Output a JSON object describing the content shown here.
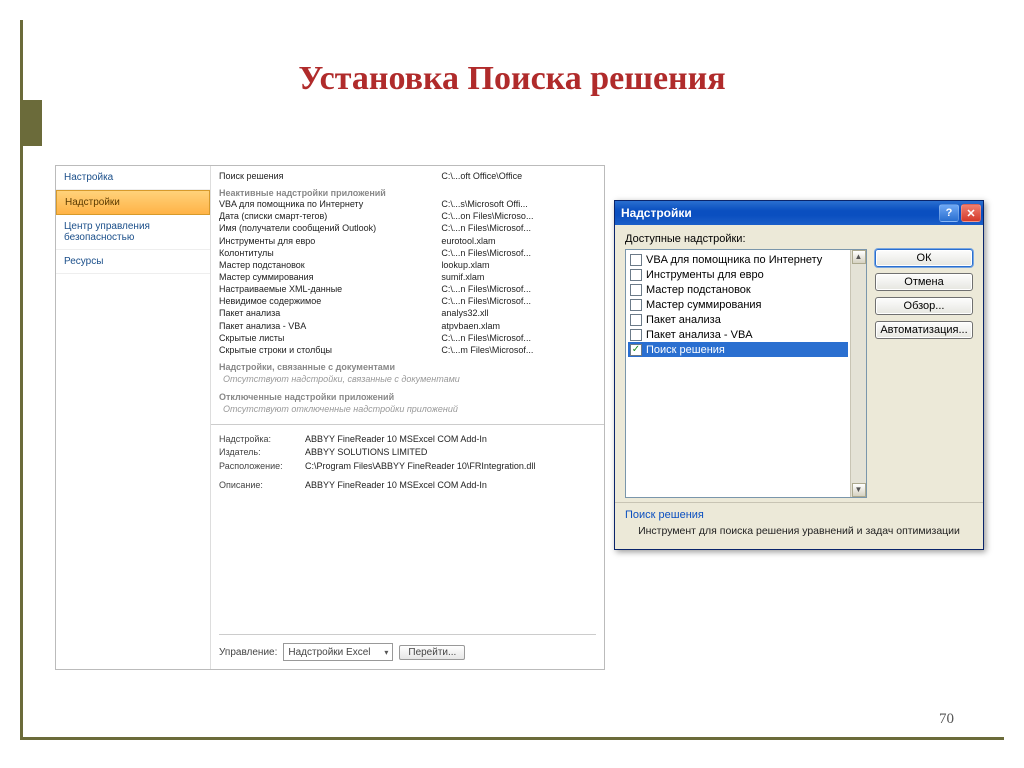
{
  "slide": {
    "title": "Установка Поиска решения",
    "page": "70"
  },
  "excel_options": {
    "sidebar": [
      "Настройка",
      "Надстройки",
      "Центр управления безопасностью",
      "Ресурсы"
    ],
    "selected_sidebar_index": 1,
    "top_item_name": "Поиск решения",
    "top_item_path": "C:\\...oft Office\\Office",
    "section_inactive": "Неактивные надстройки приложений",
    "inactive_list": [
      {
        "name": "VBA для помощника по Интернету",
        "path": "C:\\...s\\Microsoft Offi..."
      },
      {
        "name": "Дата (списки смарт-тегов)",
        "path": "C:\\...on Files\\Microso..."
      },
      {
        "name": "Имя (получатели сообщений Outlook)",
        "path": "C:\\...n Files\\Microsof..."
      },
      {
        "name": "Инструменты для евро",
        "path": "eurotool.xlam"
      },
      {
        "name": "Колонтитулы",
        "path": "C:\\...n Files\\Microsof..."
      },
      {
        "name": "Мастер подстановок",
        "path": "lookup.xlam"
      },
      {
        "name": "Мастер суммирования",
        "path": "sumif.xlam"
      },
      {
        "name": "Настраиваемые XML-данные",
        "path": "C:\\...n Files\\Microsof..."
      },
      {
        "name": "Невидимое содержимое",
        "path": "C:\\...n Files\\Microsof..."
      },
      {
        "name": "Пакет анализа",
        "path": "analys32.xll"
      },
      {
        "name": "Пакет анализа - VBA",
        "path": "atpvbaen.xlam"
      },
      {
        "name": "Скрытые листы",
        "path": "C:\\...n Files\\Microsof..."
      },
      {
        "name": "Скрытые строки и столбцы",
        "path": "C:\\...m Files\\Microsof..."
      }
    ],
    "section_doc": "Надстройки, связанные с документами",
    "doc_none": "Отсутствуют надстройки, связанные с документами",
    "section_disabled": "Отключенные надстройки приложений",
    "disabled_none": "Отсутствуют отключенные надстройки приложений",
    "details": {
      "name_label": "Надстройка:",
      "name": "ABBYY FineReader 10 MSExcel COM Add-In",
      "publisher_label": "Издатель:",
      "publisher": "ABBYY SOLUTIONS LIMITED",
      "location_label": "Расположение:",
      "location": "C:\\Program Files\\ABBYY FineReader 10\\FRIntegration.dll",
      "desc_label": "Описание:",
      "desc": "ABBYY FineReader 10 MSExcel COM Add-In"
    },
    "manage_label": "Управление:",
    "manage_value": "Надстройки Excel",
    "go_button": "Перейти..."
  },
  "addins_dialog": {
    "title": "Надстройки",
    "available_label_pre": "Д",
    "available_label_rest": "оступные надстройки:",
    "list": [
      {
        "label": "VBA для помощника по Интернету",
        "checked": false
      },
      {
        "label": "Инструменты для евро",
        "checked": false
      },
      {
        "label": "Мастер подстановок",
        "checked": false
      },
      {
        "label": "Мастер суммирования",
        "checked": false
      },
      {
        "label": "Пакет анализа",
        "checked": false
      },
      {
        "label": "Пакет анализа - VBA",
        "checked": false
      },
      {
        "label": "Поиск решения",
        "checked": true,
        "selected": true
      }
    ],
    "buttons": {
      "ok": "ОК",
      "cancel": "Отмена",
      "browse": "Обзор...",
      "automation": "Автоматизация..."
    },
    "footer_heading": "Поиск решения",
    "footer_desc": "Инструмент для поиска решения уравнений и задач оптимизации"
  }
}
